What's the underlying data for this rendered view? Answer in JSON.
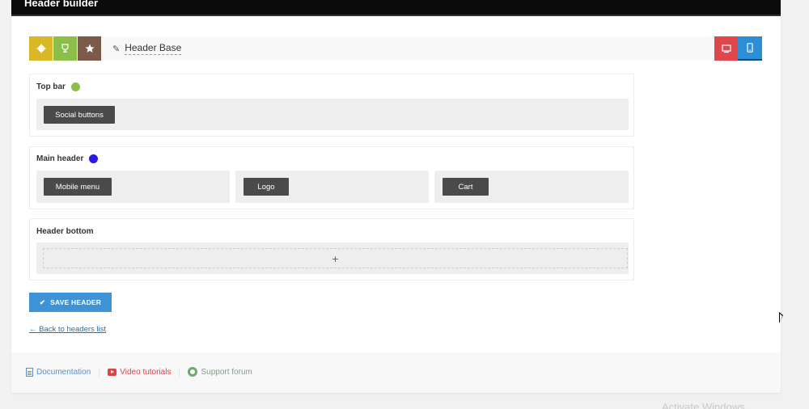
{
  "topbar": {
    "title": "Header builder"
  },
  "toolbar": {
    "header_name": "Header Base",
    "icons": [
      "gear-icon",
      "trophy-icon",
      "star-icon",
      "pencil-icon",
      "desktop-icon",
      "mobile-icon"
    ],
    "colors": {
      "settings": "#d8b925",
      "trophy": "#8bbf4a",
      "star": "#7b5a4a",
      "desktop": "#e0474d",
      "mobile": "#2b8ed6"
    }
  },
  "rows": {
    "top": {
      "title": "Top bar",
      "dot_color": "#8bbf4a",
      "elements": [
        "Social buttons"
      ]
    },
    "main": {
      "title": "Main header",
      "dot_color": "#2a1adf",
      "elements": [
        "Mobile menu",
        "Logo",
        "Cart"
      ]
    },
    "bottom": {
      "title": "Header bottom",
      "add_symbol": "+"
    }
  },
  "actions": {
    "save_label": "SAVE HEADER",
    "back_label": "← Back to headers list"
  },
  "footer": {
    "documentation": "Documentation",
    "video": "Video tutorials",
    "forum": "Support forum"
  },
  "watermark": "Activate Windows"
}
